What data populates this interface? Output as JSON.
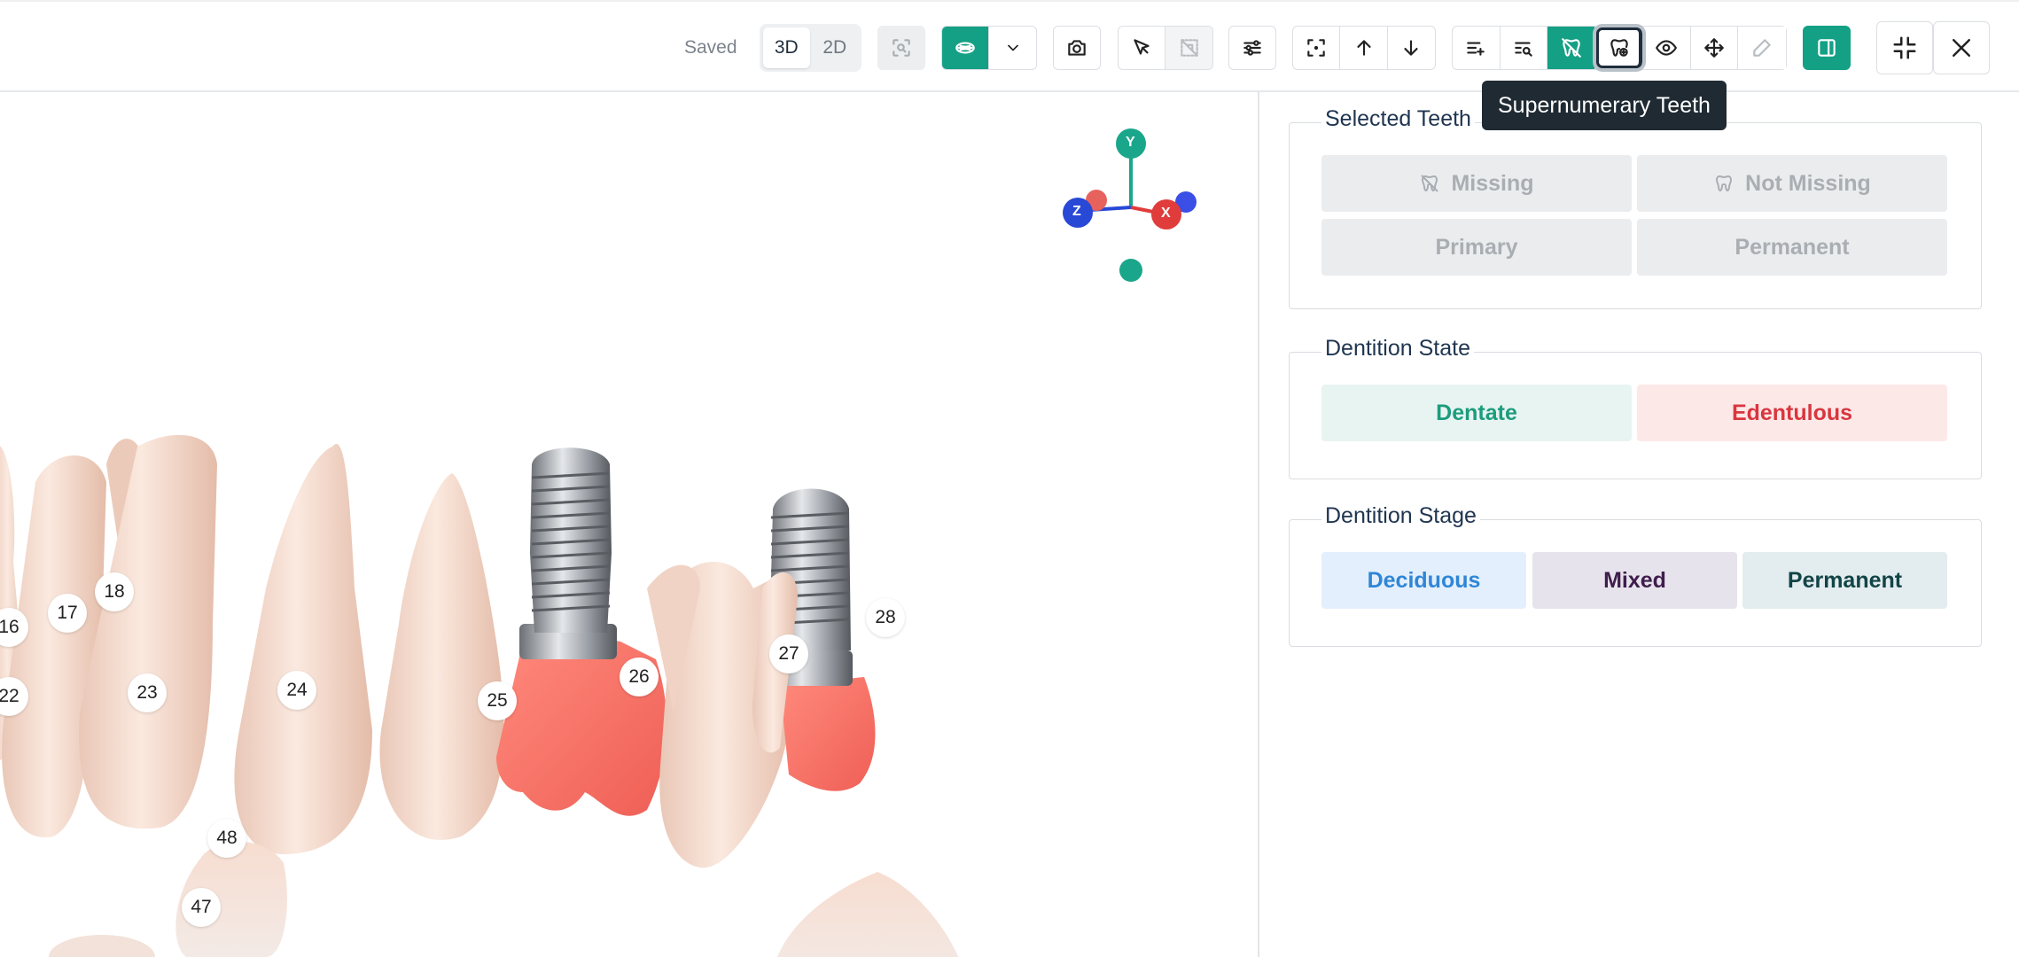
{
  "toolbar": {
    "saved_label": "Saved",
    "view_modes": [
      "3D",
      "2D"
    ],
    "active_view_mode": "3D"
  },
  "tooltip": {
    "text": "Supernumerary Teeth"
  },
  "viewport": {
    "tooth_labels": [
      "16",
      "17",
      "18",
      "22",
      "23",
      "24",
      "25",
      "26",
      "27",
      "28",
      "48",
      "47"
    ],
    "axis": {
      "y": "Y",
      "z": "Z",
      "x": "X"
    }
  },
  "panel": {
    "selected_teeth": {
      "title": "Selected Teeth",
      "missing": "Missing",
      "not_missing": "Not Missing",
      "primary": "Primary",
      "permanent": "Permanent"
    },
    "dentition_state": {
      "title": "Dentition State",
      "dentate": "Dentate",
      "edentulous": "Edentulous"
    },
    "dentition_stage": {
      "title": "Dentition Stage",
      "deciduous": "Deciduous",
      "mixed": "Mixed",
      "permanent": "Permanent"
    }
  },
  "colors": {
    "accent": "#14a085",
    "dentate_bg": "#e8f4f1",
    "dentate_text": "#1c9c7e",
    "edentulous_bg": "#fde8e8",
    "edentulous_text": "#d9363e",
    "deciduous_bg": "#e3effc",
    "deciduous_text": "#2f86d6",
    "mixed_bg": "#e7e3ec",
    "mixed_text": "#3f1d4d",
    "permanent_bg": "#e3ecee",
    "permanent_text": "#124446"
  }
}
